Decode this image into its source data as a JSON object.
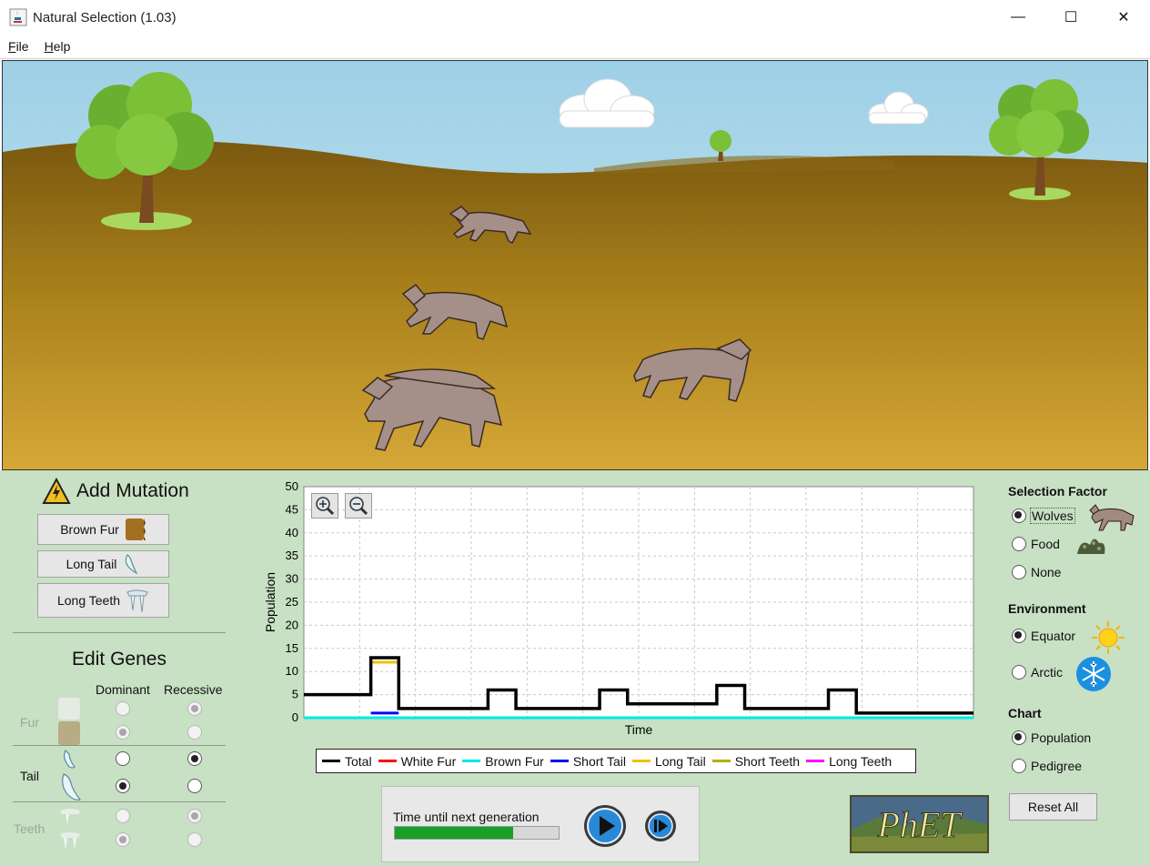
{
  "window": {
    "title": "Natural Selection (1.03)",
    "minimize_glyph": "—",
    "maximize_glyph": "☐",
    "close_glyph": "✕"
  },
  "menu": {
    "items": [
      "File",
      "Help"
    ]
  },
  "mutation": {
    "title": "Add Mutation",
    "buttons": [
      {
        "label": "Brown Fur",
        "icon": "brown-fur-icon"
      },
      {
        "label": "Long Tail",
        "icon": "long-tail-icon"
      },
      {
        "label": "Long Teeth",
        "icon": "long-teeth-icon"
      }
    ]
  },
  "genes": {
    "title": "Edit Genes",
    "dominant_label": "Dominant",
    "recessive_label": "Recessive",
    "rows": [
      {
        "label": "Fur",
        "enabled": false,
        "dominant": null,
        "recessive": "white"
      },
      {
        "label": "Tail",
        "enabled": true,
        "dominant": "long",
        "recessive": "short"
      },
      {
        "label": "Teeth",
        "enabled": false,
        "dominant": "long",
        "recessive": "short"
      }
    ]
  },
  "chart_data": {
    "type": "line",
    "ylabel": "Population",
    "xlabel": "Time",
    "ylim": [
      0,
      50
    ],
    "yticks": [
      0,
      5,
      10,
      15,
      20,
      25,
      30,
      35,
      40,
      45,
      50
    ],
    "grid": true,
    "legend_position": "bottom",
    "series": [
      {
        "name": "Total",
        "color": "#000000",
        "points": [
          [
            0,
            5
          ],
          [
            12,
            5
          ],
          [
            12,
            13
          ],
          [
            17,
            13
          ],
          [
            17,
            2
          ],
          [
            33,
            2
          ],
          [
            33,
            6
          ],
          [
            38,
            6
          ],
          [
            38,
            2
          ],
          [
            53,
            2
          ],
          [
            53,
            6
          ],
          [
            58,
            6
          ],
          [
            58,
            3
          ],
          [
            74,
            3
          ],
          [
            74,
            7
          ],
          [
            79,
            7
          ],
          [
            79,
            2
          ],
          [
            94,
            2
          ],
          [
            94,
            6
          ],
          [
            99,
            6
          ],
          [
            99,
            1
          ],
          [
            120,
            1
          ]
        ]
      },
      {
        "name": "White Fur",
        "color": "#ff0000",
        "points": [
          [
            0,
            0
          ],
          [
            120,
            0
          ]
        ]
      },
      {
        "name": "Brown Fur",
        "color": "#00e8e8",
        "points": [
          [
            0,
            0
          ],
          [
            120,
            0
          ]
        ]
      },
      {
        "name": "Short Tail",
        "color": "#0000ff",
        "points": [
          [
            12,
            1
          ],
          [
            17,
            1
          ]
        ]
      },
      {
        "name": "Long Tail",
        "color": "#f0c000",
        "points": [
          [
            12,
            12
          ],
          [
            17,
            12
          ]
        ]
      },
      {
        "name": "Short Teeth",
        "color": "#b0b000",
        "points": []
      },
      {
        "name": "Long Teeth",
        "color": "#ff00ff",
        "points": []
      }
    ]
  },
  "timer": {
    "label": "Time until next generation",
    "progress": 0.72
  },
  "selection_factor": {
    "title": "Selection Factor",
    "options": [
      {
        "label": "Wolves",
        "checked": true,
        "icon": "wolf-icon"
      },
      {
        "label": "Food",
        "checked": false,
        "icon": "food-icon"
      },
      {
        "label": "None",
        "checked": false
      }
    ]
  },
  "environment": {
    "title": "Environment",
    "options": [
      {
        "label": "Equator",
        "checked": true,
        "icon": "sun-icon"
      },
      {
        "label": "Arctic",
        "checked": false,
        "icon": "snowflake-icon"
      }
    ]
  },
  "chart_select": {
    "title": "Chart",
    "options": [
      {
        "label": "Population",
        "checked": true
      },
      {
        "label": "Pedigree",
        "checked": false
      }
    ]
  },
  "reset_label": "Reset All",
  "logo_text": "PhET"
}
